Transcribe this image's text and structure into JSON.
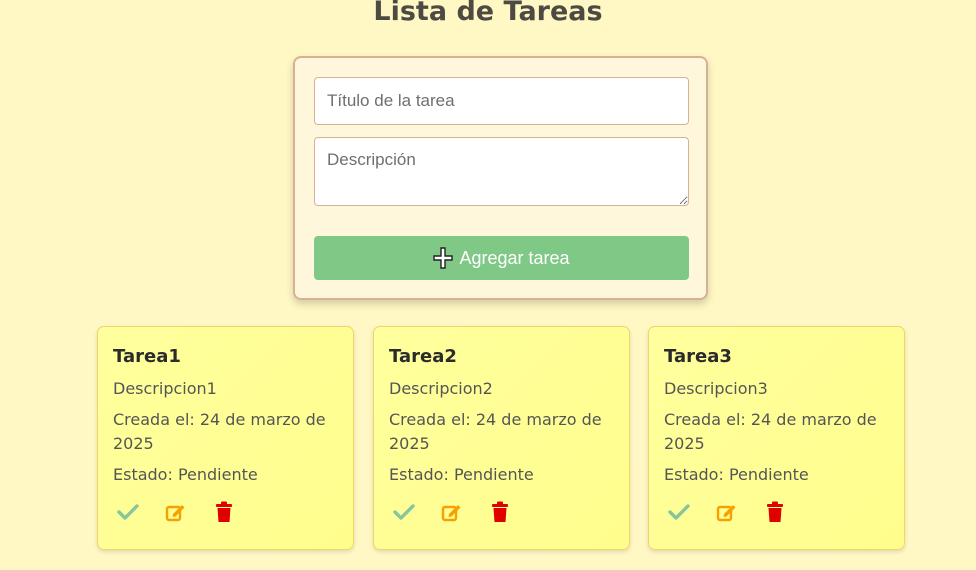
{
  "page": {
    "title": "Lista de Tareas"
  },
  "form": {
    "title_placeholder": "Título de la tarea",
    "title_value": "",
    "description_placeholder": "Descripción",
    "description_value": "",
    "add_button_label": "Agregar tarea",
    "add_button_icon": "plus-icon"
  },
  "tasks": [
    {
      "title": "Tarea1",
      "description": "Descripcion1",
      "created": "Creada el: 24 de marzo de 2025",
      "status": "Estado: Pendiente"
    },
    {
      "title": "Tarea2",
      "description": "Descripcion2",
      "created": "Creada el: 24 de marzo de 2025",
      "status": "Estado: Pendiente"
    },
    {
      "title": "Tarea3",
      "description": "Descripcion3",
      "created": "Creada el: 24 de marzo de 2025",
      "status": "Estado: Pendiente"
    }
  ],
  "actions": {
    "complete_icon": "check-icon",
    "edit_icon": "edit-icon",
    "delete_icon": "trash-icon"
  },
  "colors": {
    "background": "#fff8c4",
    "add_button": "#80c886",
    "check": "#86c69a",
    "edit": "#f7a000",
    "delete": "#e00000",
    "card": "#ffff9e"
  }
}
